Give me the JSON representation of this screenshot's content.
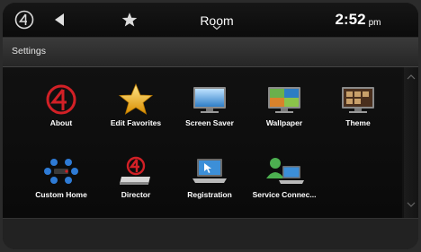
{
  "topbar": {
    "room": "Room",
    "time": "2:52",
    "ampm": "pm"
  },
  "section": {
    "title": "Settings"
  },
  "tiles": [
    {
      "label": "About",
      "icon": "control4-logo-icon"
    },
    {
      "label": "Edit Favorites",
      "icon": "star-icon"
    },
    {
      "label": "Screen Saver",
      "icon": "monitor-icon"
    },
    {
      "label": "Wallpaper",
      "icon": "wallpaper-icon"
    },
    {
      "label": "Theme",
      "icon": "theme-icon"
    },
    {
      "label": "Custom Home",
      "icon": "custom-home-icon"
    },
    {
      "label": "Director",
      "icon": "director-icon"
    },
    {
      "label": "Registration",
      "icon": "laptop-icon"
    },
    {
      "label": "Service Connec...",
      "icon": "service-connect-icon"
    }
  ]
}
